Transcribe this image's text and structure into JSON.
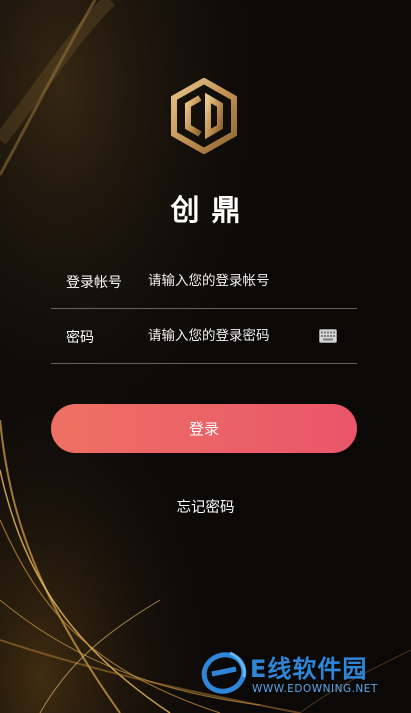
{
  "app": {
    "title": "创鼎",
    "logo_icon": "hexagon-cd-logo-icon"
  },
  "form": {
    "account": {
      "label": "登录帐号",
      "placeholder": "请输入您的登录帐号",
      "value": ""
    },
    "password": {
      "label": "密码",
      "placeholder": "请输入您的登录密码",
      "value": "",
      "keyboard_icon": "keyboard-icon"
    }
  },
  "login_button": {
    "label": "登录"
  },
  "forgot_password": {
    "label": "忘记密码"
  },
  "watermark": {
    "name": "E线软件园",
    "site": "WWW.EDOWNING.NET"
  },
  "colors": {
    "background": "#0b0908",
    "gold": "#c8a25e",
    "button_start": "#ee7063",
    "button_end": "#e9566a",
    "watermark_blue": "#2f86d8"
  }
}
